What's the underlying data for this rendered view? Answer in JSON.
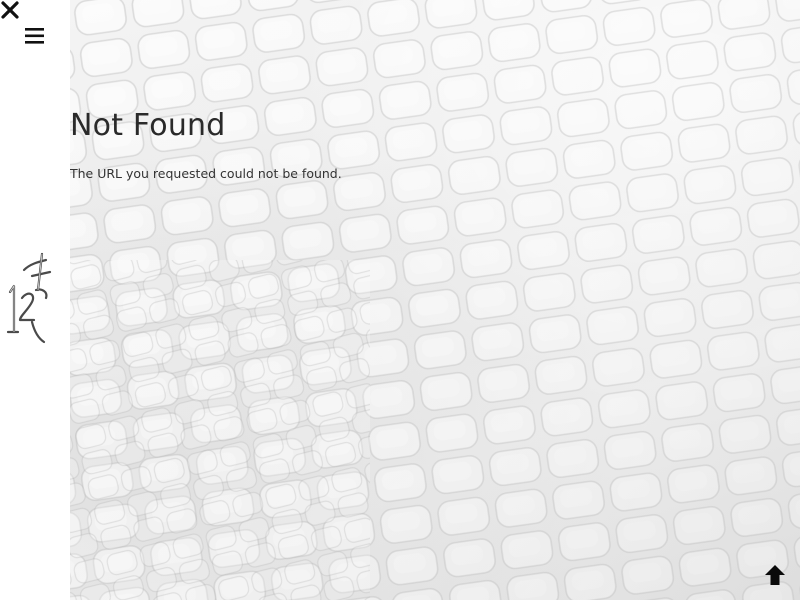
{
  "header": {
    "close_icon": "close-icon",
    "menu_icon": "hamburger-menu-icon"
  },
  "logo": {
    "text": "124"
  },
  "main": {
    "title": "Not Found",
    "message": "The URL you requested could not be found."
  },
  "footer": {
    "scroll_top_icon": "arrow-up-icon"
  },
  "colors": {
    "sidebar_bg": "#ffffff",
    "text": "#2a2a2a",
    "icon": "#111111",
    "texture_base": "#eeeeee"
  }
}
